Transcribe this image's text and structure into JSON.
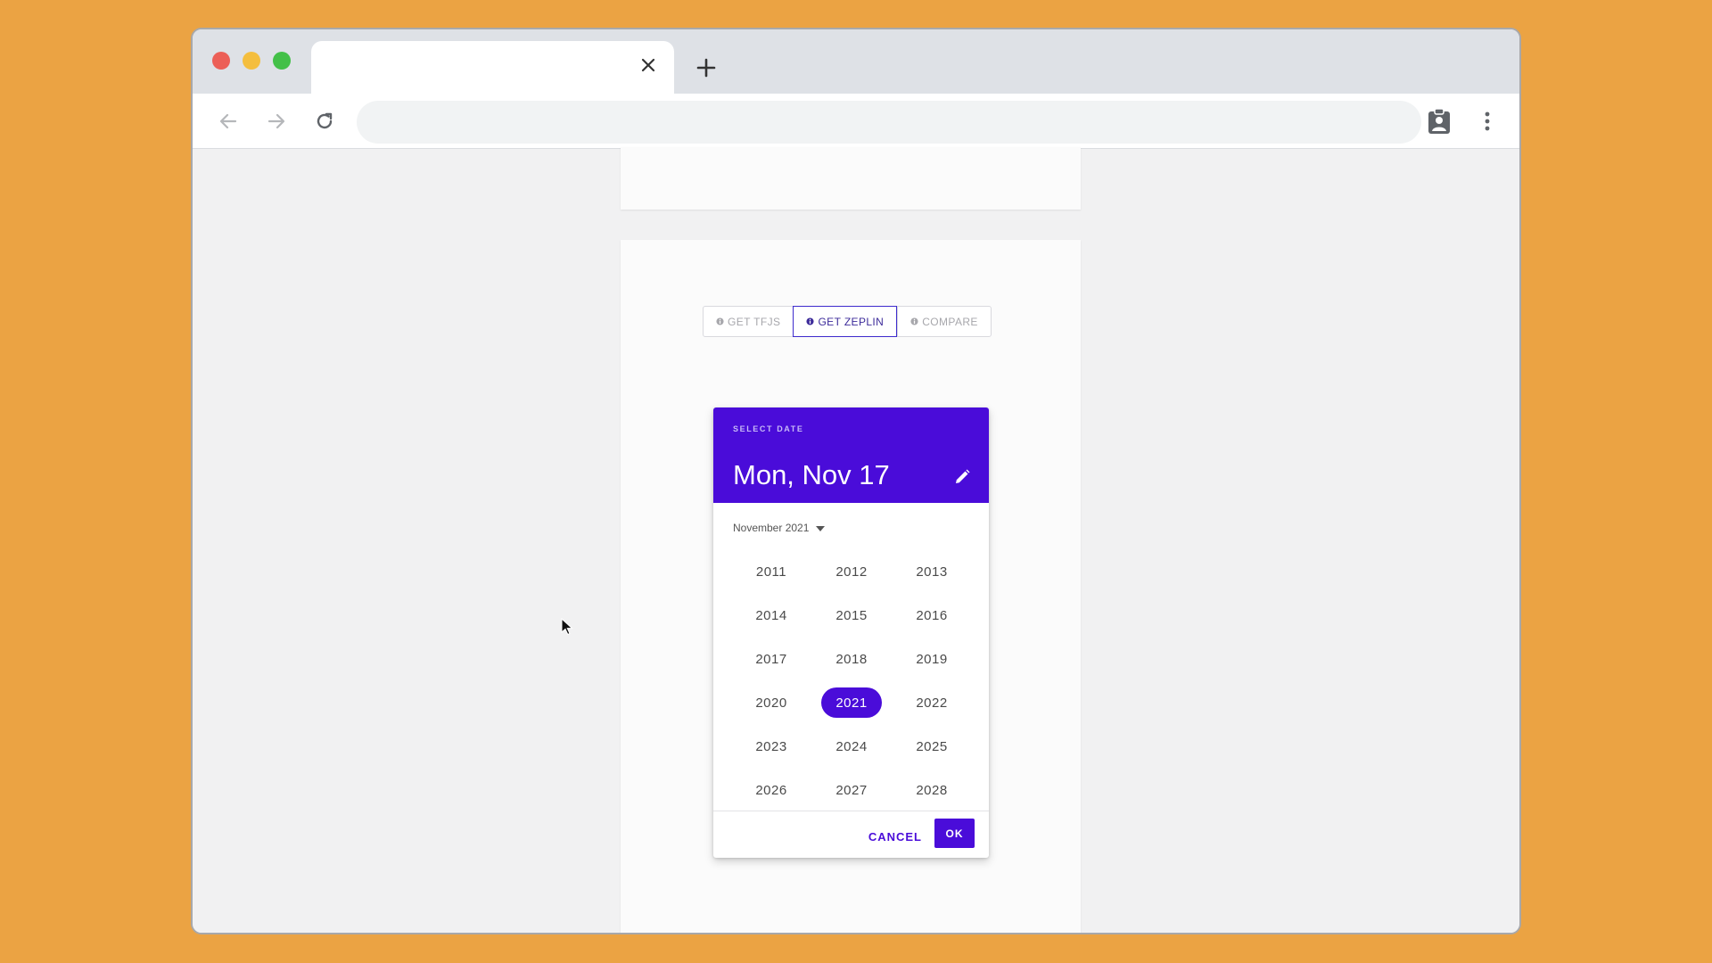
{
  "browser": {
    "tab_title": "",
    "address": "",
    "colors": {
      "window_chrome": "#DEE1E6",
      "backdrop": "#EBA343"
    }
  },
  "icons": {
    "close": "close-icon",
    "new_tab": "plus-icon",
    "back": "arrow-left-icon",
    "forward": "arrow-right-icon",
    "reload": "reload-icon",
    "extension": "clipboard-person-icon",
    "menu": "kebab-menu-icon",
    "edit": "pencil-icon",
    "dropdown": "caret-down-icon"
  },
  "segmented": {
    "items": [
      {
        "label": "GET TFJS",
        "active": false
      },
      {
        "label": "GET ZEPLIN",
        "active": true
      },
      {
        "label": "COMPARE",
        "active": false
      }
    ]
  },
  "datepicker": {
    "overline": "SELECT DATE",
    "headline": "Mon, Nov 17",
    "month_label": "November 2021",
    "years": [
      "2011",
      "2012",
      "2013",
      "2014",
      "2015",
      "2016",
      "2017",
      "2018",
      "2019",
      "2020",
      "2021",
      "2022",
      "2023",
      "2024",
      "2025",
      "2026",
      "2027",
      "2028"
    ],
    "selected_year": "2021",
    "cancel_label": "CANCEL",
    "ok_label": "OK",
    "accent_color": "#4A0CD9"
  }
}
